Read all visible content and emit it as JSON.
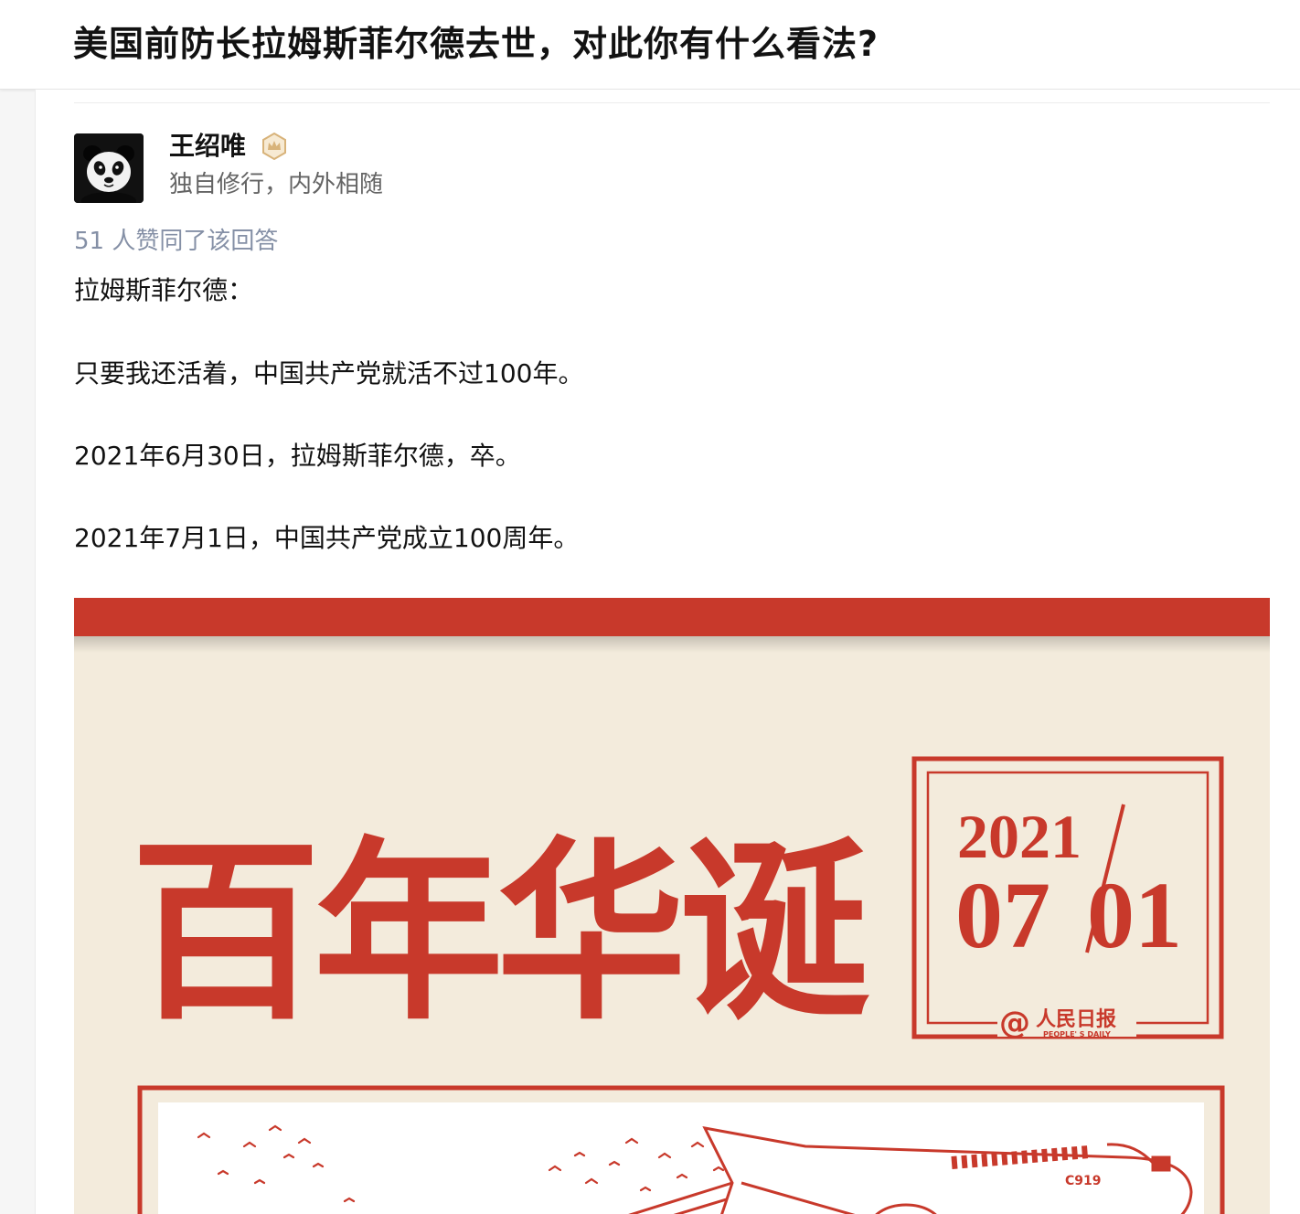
{
  "question": {
    "title": "美国前防长拉姆斯菲尔德去世，对此你有什么看法?"
  },
  "author": {
    "avatar_icon": "panda-avatar",
    "name": "王绍唯",
    "badge_icon": "crown-badge-icon",
    "bio": "独自修行，内外相随"
  },
  "answer": {
    "votes_text": "51 人赞同了该回答",
    "paragraphs": [
      "拉姆斯菲尔德：",
      "只要我还活着，中国共产党就活不过100年。",
      "2021年6月30日，拉姆斯菲尔德，卒。",
      "2021年7月1日，中国共产党成立100周年。"
    ]
  },
  "poster": {
    "headline": "百年华诞",
    "date_year": "2021",
    "date_month": "07",
    "date_day": "01",
    "brand": "人民日报",
    "brand_en": "PEOPLE' S DAILY",
    "aircraft_mark": "C919"
  },
  "colors": {
    "poster_red": "#c8392b",
    "poster_bg": "#f3ebdc",
    "vote_text": "#8590a6",
    "badge_gold": "#d8b37a"
  }
}
